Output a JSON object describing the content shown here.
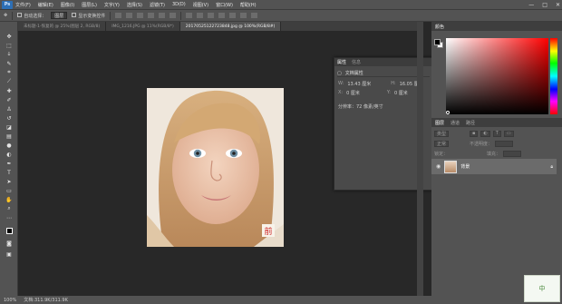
{
  "app": {
    "logo": "Ps"
  },
  "menu": [
    "文件(F)",
    "编辑(E)",
    "图像(I)",
    "图层(L)",
    "文字(Y)",
    "选择(S)",
    "滤镜(T)",
    "3D(D)",
    "视图(V)",
    "窗口(W)",
    "帮助(H)"
  ],
  "window_controls": [
    "—",
    "□",
    "✕"
  ],
  "options": {
    "auto_select": "自动选择：",
    "target": "图层",
    "show_transform": "显示变换控件"
  },
  "tabs": [
    {
      "label": "未标题-1-恢复的 @ 25%(图层 2, RGB/8)",
      "active": false
    },
    {
      "label": "IMG_1216.JPG @ 11%(RGB/8*)",
      "active": false
    },
    {
      "label": "20170525122723848.jpg @ 100%(RGB/8#)",
      "active": true
    }
  ],
  "properties_panel": {
    "tabs": [
      "属性",
      "信息"
    ],
    "doc_props": "文档属性",
    "W_label": "W:",
    "W_value": "13.43 厘米",
    "H_label": "H:",
    "H_value": "16.05 厘米",
    "X_label": "X:",
    "X_value": "0 厘米",
    "Y_label": "Y:",
    "Y_value": "0 厘米",
    "resolution": "分辨率：72 像素/英寸"
  },
  "color_panel": {
    "title": "颜色"
  },
  "layers_panel": {
    "tabs": [
      "图层",
      "通道",
      "路径"
    ],
    "filter": "类型",
    "mode": "正常",
    "opacity": "不透明度：",
    "lock": "锁定：",
    "fill": "填充：",
    "layer_name": "背景"
  },
  "photo_badge": "前",
  "status": {
    "zoom": "100%",
    "doc": "文档:311.9K/311.9K"
  },
  "watermark": "中"
}
